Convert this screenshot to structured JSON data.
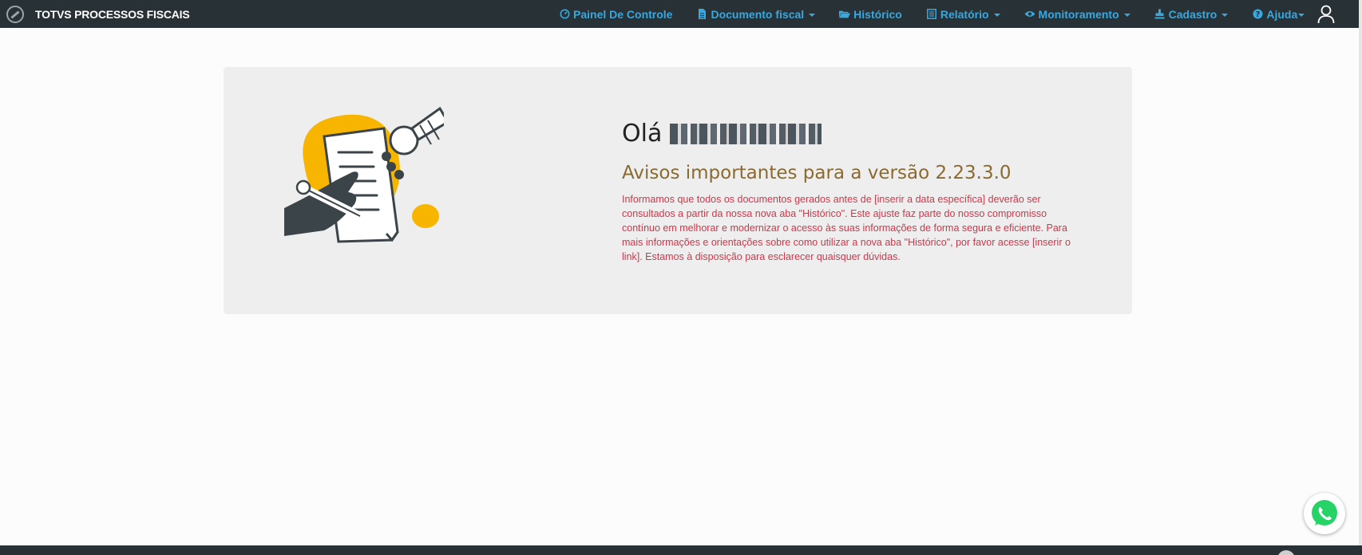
{
  "app": {
    "title": "TOTVS PROCESSOS FISCAIS"
  },
  "nav": {
    "items": [
      {
        "label": "Painel De Controle",
        "icon": "dashboard-icon",
        "dropdown": false
      },
      {
        "label": "Documento fiscal",
        "icon": "document-icon",
        "dropdown": true
      },
      {
        "label": "Histórico",
        "icon": "folder-open-icon",
        "dropdown": false
      },
      {
        "label": "Relatório",
        "icon": "report-icon",
        "dropdown": true
      },
      {
        "label": "Monitoramento",
        "icon": "eye-icon",
        "dropdown": true
      },
      {
        "label": "Cadastro",
        "icon": "stamp-icon",
        "dropdown": true
      },
      {
        "label": "Ajuda",
        "icon": "help-icon",
        "dropdown": true
      }
    ],
    "user_icon": "user-icon"
  },
  "main": {
    "greeting": "Olá",
    "name_redacted": true,
    "notice_title": "Avisos importantes para a versão 2.23.3.0",
    "notice_body": "Informamos que todos os documentos gerados antes de [inserir a data específica] deverão ser consultados a partir da nossa nova aba \"Histórico\". Este ajuste faz parte do nosso compromisso contínuo em melhorar e modernizar o acesso às suas informações de forma segura e eficiente. Para mais informações e orientações sobre como utilizar a nova aba \"Histórico\", por favor acesse [inserir o link]. Estamos à disposição para esclarecer quaisquer dúvidas."
  },
  "colors": {
    "topbar": "#283135",
    "nav_link": "#3aa7dd",
    "notice_title": "#8a6a2e",
    "notice_body": "#d0364a",
    "illustration_accent": "#f7b500",
    "whatsapp": "#25d366"
  },
  "floating": {
    "whatsapp_icon": "whatsapp-icon"
  }
}
